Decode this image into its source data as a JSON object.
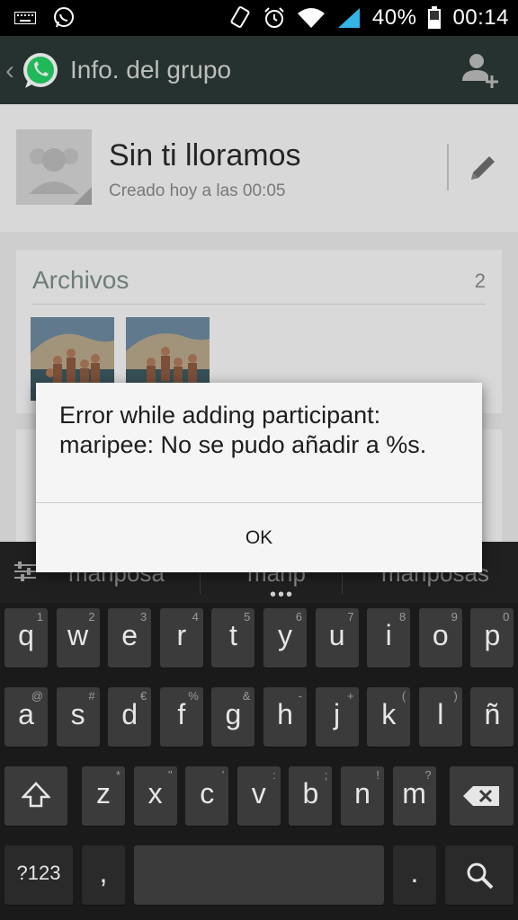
{
  "status_bar": {
    "battery": "40%",
    "time": "00:14",
    "icons": [
      "keyboard-icon",
      "whatsapp-notification-icon",
      "rotate-icon",
      "alarm-icon",
      "wifi-icon",
      "signal-icon",
      "battery-icon"
    ]
  },
  "action_bar": {
    "title": "Info. del grupo",
    "icons": [
      "back-chevron-icon",
      "whatsapp-logo-icon",
      "add-participant-icon"
    ]
  },
  "group": {
    "name": "Sin ti lloramos",
    "created": "Creado hoy a las 00:05"
  },
  "files": {
    "title": "Archivos",
    "count": "2"
  },
  "dialog": {
    "message": "Error while adding participant:\nmaripee: No se pudo añadir a %s.",
    "ok_label": "OK"
  },
  "keyboard": {
    "suggestions": [
      "mariposa",
      "marip",
      "mariposas"
    ],
    "row1": [
      {
        "k": "q",
        "h": "1"
      },
      {
        "k": "w",
        "h": "2"
      },
      {
        "k": "e",
        "h": "3"
      },
      {
        "k": "r",
        "h": "4"
      },
      {
        "k": "t",
        "h": "5"
      },
      {
        "k": "y",
        "h": "6"
      },
      {
        "k": "u",
        "h": "7"
      },
      {
        "k": "i",
        "h": "8"
      },
      {
        "k": "o",
        "h": "9"
      },
      {
        "k": "p",
        "h": "0"
      }
    ],
    "row2": [
      {
        "k": "a",
        "h": "@"
      },
      {
        "k": "s",
        "h": "#"
      },
      {
        "k": "d",
        "h": "€"
      },
      {
        "k": "f",
        "h": "%"
      },
      {
        "k": "g",
        "h": "&"
      },
      {
        "k": "h",
        "h": "-"
      },
      {
        "k": "j",
        "h": "+"
      },
      {
        "k": "k",
        "h": "("
      },
      {
        "k": "l",
        "h": ")"
      },
      {
        "k": "ñ",
        "h": ""
      }
    ],
    "row3": [
      {
        "k": "z",
        "h": "*"
      },
      {
        "k": "x",
        "h": "\""
      },
      {
        "k": "c",
        "h": "'"
      },
      {
        "k": "v",
        "h": ":"
      },
      {
        "k": "b",
        "h": ";"
      },
      {
        "k": "n",
        "h": "!"
      },
      {
        "k": "m",
        "h": "?"
      }
    ],
    "symbols_label": "?123",
    "comma": ",",
    "period": "."
  },
  "colors": {
    "action_bar": "#2b3a36",
    "whatsapp_green": "#25d366",
    "files_title": "#7d8f8b"
  }
}
